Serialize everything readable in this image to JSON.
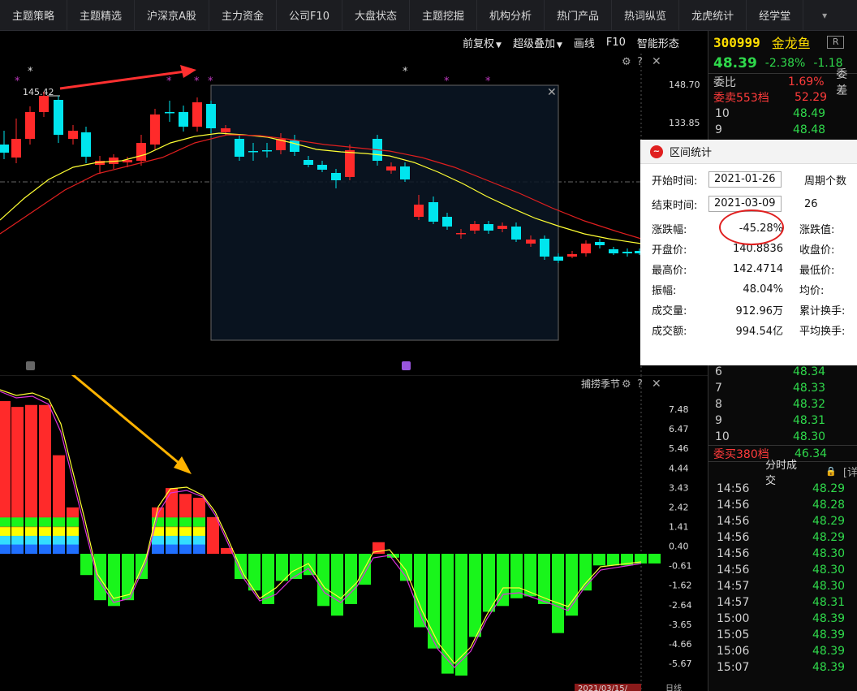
{
  "topnav": {
    "items": [
      "主题策略",
      "主题精选",
      "沪深京A股",
      "主力资金",
      "公司F10",
      "大盘状态",
      "主题挖掘",
      "机构分析",
      "热门产品",
      "热词纵览",
      "龙虎统计",
      "经学堂"
    ],
    "icon": "caret-down-icon"
  },
  "charttools": {
    "items": [
      "前复权",
      "超级叠加",
      "画线",
      "F10",
      "智能形态"
    ]
  },
  "main_chart": {
    "high_label": "145.42",
    "price_axis": [
      "148.70",
      "133.85"
    ],
    "icons": [
      "gear-icon",
      "help-icon",
      "close-icon"
    ]
  },
  "indicator": {
    "title": "捕捞季节",
    "axis": [
      "7.48",
      "6.47",
      "5.46",
      "4.44",
      "3.43",
      "2.42",
      "1.41",
      "0.40",
      "-0.61",
      "-1.62",
      "-2.64",
      "-3.65",
      "-4.66",
      "-5.67"
    ],
    "icons": [
      "gear-icon",
      "help-icon",
      "close-icon"
    ]
  },
  "stock": {
    "code": "300999",
    "name": "金龙鱼",
    "box": "R",
    "price": "48.39",
    "pct": "-2.38%",
    "change": "-1.18"
  },
  "orderbook": {
    "weibi_label": "委比",
    "weibi_value": "1.69%",
    "weicha_label": "委差",
    "sell_label": "委卖553档",
    "sell_price": "52.29",
    "top_levels": [
      {
        "lvl": "10",
        "price": "48.49"
      },
      {
        "lvl": "9",
        "price": "48.48"
      }
    ],
    "bottom_levels": [
      {
        "lvl": "6",
        "price": "48.34"
      },
      {
        "lvl": "7",
        "price": "48.33"
      },
      {
        "lvl": "8",
        "price": "48.32"
      },
      {
        "lvl": "9",
        "price": "48.31"
      },
      {
        "lvl": "10",
        "price": "48.30"
      }
    ],
    "buy_label": "委买380档",
    "buy_price": "46.34"
  },
  "ticks": {
    "header": "分时成交",
    "lock_icon": "lock-icon",
    "header_right": "[详",
    "rows": [
      {
        "t": "14:56",
        "p": "48.29"
      },
      {
        "t": "14:56",
        "p": "48.28"
      },
      {
        "t": "14:56",
        "p": "48.29"
      },
      {
        "t": "14:56",
        "p": "48.29"
      },
      {
        "t": "14:56",
        "p": "48.30"
      },
      {
        "t": "14:56",
        "p": "48.30"
      },
      {
        "t": "14:57",
        "p": "48.30"
      },
      {
        "t": "14:57",
        "p": "48.31"
      },
      {
        "t": "15:00",
        "p": "48.39"
      },
      {
        "t": "15:05",
        "p": "48.39"
      },
      {
        "t": "15:06",
        "p": "48.39"
      },
      {
        "t": "15:07",
        "p": "48.39"
      }
    ]
  },
  "popup": {
    "title": "区间统计",
    "start_label": "开始时间:",
    "start_value": "2021-01-26",
    "end_label": "结束时间:",
    "end_value": "2021-03-09",
    "period_label": "周期个数",
    "period_value": "26",
    "rows": [
      {
        "l": "涨跌幅:",
        "v": "-45.28%",
        "l2": "涨跌值:"
      },
      {
        "l": "开盘价:",
        "v": "140.8836",
        "l2": "收盘价:"
      },
      {
        "l": "最高价:",
        "v": "142.4714",
        "l2": "最低价:"
      },
      {
        "l": "振幅:",
        "v": "48.04%",
        "l2": "均价:"
      },
      {
        "l": "成交量:",
        "v": "912.96万",
        "l2": "累计换手:"
      },
      {
        "l": "成交额:",
        "v": "994.54亿",
        "l2": "平均换手:"
      }
    ]
  },
  "bottom": {
    "date_badge": "2021/03/15/",
    "suffix": "日线"
  },
  "colors": {
    "up": "#ff2a2a",
    "down": "#00e5ee",
    "bar_green": "#19f51b",
    "ma_yellow": "#ffff33",
    "ma_red": "#e01f1f",
    "arrow_red": "#ff3030",
    "arrow_orange": "#ffb300"
  }
}
